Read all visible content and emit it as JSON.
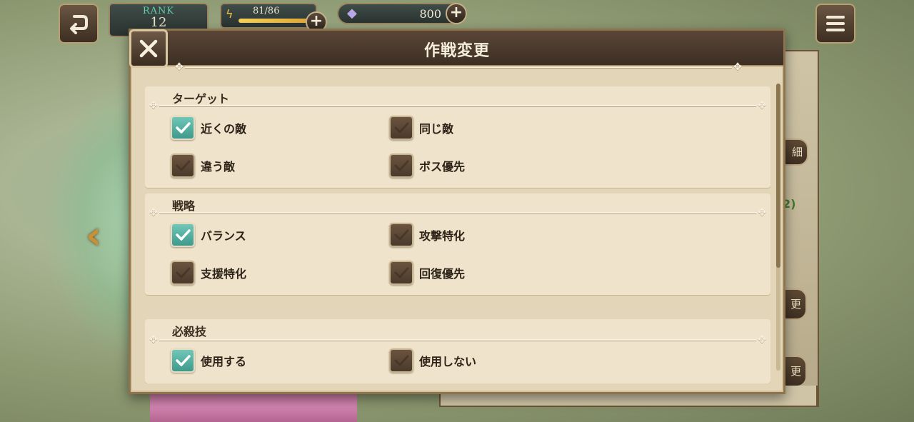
{
  "hud": {
    "rank_label": "RANK",
    "rank_value": "12",
    "stamina_text": "81/86",
    "stamina_fraction": 0.94,
    "gem_value": "800"
  },
  "modal": {
    "title": "作戦変更"
  },
  "background": {
    "side_tab_1": "細",
    "side_green_text": "2)",
    "side_tab_2": "更",
    "side_tab_3": "更"
  },
  "sections": {
    "target": {
      "title": "ターゲット",
      "options": [
        {
          "label": "近くの敵",
          "checked": true
        },
        {
          "label": "同じ敵",
          "checked": false
        },
        {
          "label": "違う敵",
          "checked": false
        },
        {
          "label": "ボス優先",
          "checked": false
        }
      ]
    },
    "strategy": {
      "title": "戦略",
      "options": [
        {
          "label": "バランス",
          "checked": true
        },
        {
          "label": "攻撃特化",
          "checked": false
        },
        {
          "label": "支援特化",
          "checked": false
        },
        {
          "label": "回復優先",
          "checked": false
        }
      ]
    },
    "special": {
      "title": "必殺技",
      "options": [
        {
          "label": "使用する",
          "checked": true
        },
        {
          "label": "使用しない",
          "checked": false
        }
      ]
    }
  },
  "colors": {
    "checked": "#4fae9f",
    "unchecked": "#5a4633",
    "panel": "#efe4cb",
    "header": "#4a3a2c"
  }
}
